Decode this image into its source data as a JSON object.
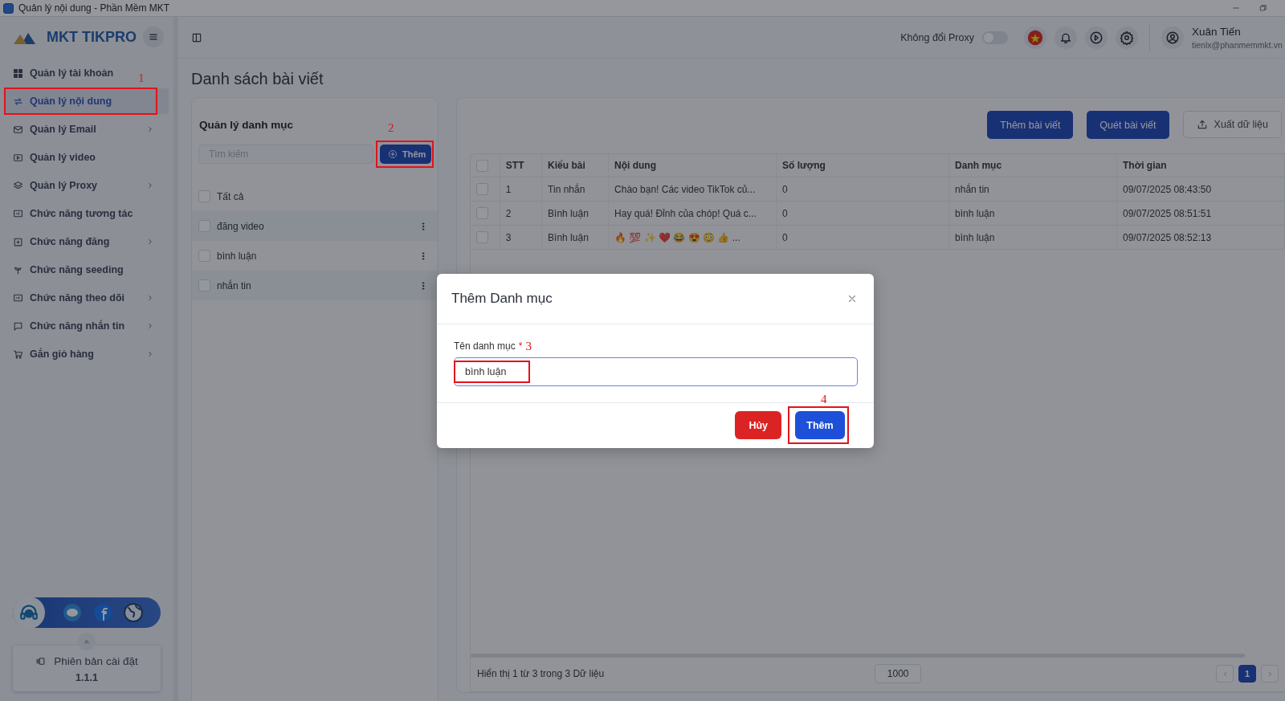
{
  "window": {
    "title": "Quản lý nội dung - Phần Mềm MKT"
  },
  "sidebar": {
    "logo": "MKT TIKPRO",
    "items": [
      {
        "label": "Quản lý tài khoản",
        "selected": false,
        "has_submenu": false
      },
      {
        "label": "Quản lý nội dung",
        "selected": true,
        "has_submenu": false,
        "annotation": "1"
      },
      {
        "label": "Quản lý Email",
        "selected": false,
        "has_submenu": true
      },
      {
        "label": "Quản lý video",
        "selected": false,
        "has_submenu": false
      },
      {
        "label": "Quản lý Proxy",
        "selected": false,
        "has_submenu": true
      },
      {
        "label": "Chức năng tương tác",
        "selected": false,
        "has_submenu": false
      },
      {
        "label": "Chức năng đăng",
        "selected": false,
        "has_submenu": true
      },
      {
        "label": "Chức năng seeding",
        "selected": false,
        "has_submenu": false
      },
      {
        "label": "Chức năng theo dõi",
        "selected": false,
        "has_submenu": true
      },
      {
        "label": "Chức năng nhắn tin",
        "selected": false,
        "has_submenu": true
      },
      {
        "label": "Gắn giỏ hàng",
        "selected": false,
        "has_submenu": true
      }
    ],
    "version": {
      "label": "Phiên bản cài đặt",
      "value": "1.1.1"
    }
  },
  "topbar": {
    "proxy_label": "Không đổi Proxy",
    "proxy_on": false,
    "user_name": "Xuân Tiến",
    "user_email": "tienlx@phanmemmkt.vn"
  },
  "page_title": "Danh sách bài viết",
  "category_panel": {
    "title": "Quản lý danh mục",
    "search": {
      "placeholder": "Tìm kiếm"
    },
    "add_button": {
      "label": "Thêm",
      "annotation": "2"
    },
    "items": [
      {
        "label": "Tất cả",
        "checked": false
      },
      {
        "label": "đăng video",
        "checked": false
      },
      {
        "label": "bình luận",
        "checked": false
      },
      {
        "label": "nhắn tin",
        "checked": false
      }
    ]
  },
  "posts_panel": {
    "buttons": [
      {
        "label": "Thêm bài viết",
        "kind": "primary"
      },
      {
        "label": "Quét bài viết",
        "kind": "primary"
      },
      {
        "label": "Xuất dữ liệu",
        "kind": "export"
      }
    ],
    "table": {
      "all_checked": false,
      "columns": [
        "STT",
        "Kiểu bài",
        "Nội dung",
        "Số lượng",
        "Danh mục",
        "Thời gian"
      ],
      "rows": [
        {
          "checked": false,
          "cells": [
            "1",
            "Tin nhắn",
            "Chào bạn! Các video TikTok củ...",
            "0",
            "nhắn tin",
            "09/07/2025 08:43:50"
          ]
        },
        {
          "checked": false,
          "cells": [
            "2",
            "Bình luận",
            "Hay quá! Đỉnh của chóp! Quá c...",
            "0",
            "bình luận",
            "09/07/2025 08:51:51"
          ]
        },
        {
          "checked": false,
          "cells": [
            "3",
            "Bình luận",
            "🔥 💯 ✨ ❤️ 😂 😍 😳 👍 ...",
            "0",
            "bình luận",
            "09/07/2025 08:52:13"
          ]
        }
      ]
    },
    "footer": {
      "summary": "Hiển thị 1 từ 3 trong 3 Dữ liệu",
      "page_size": "1000",
      "pages": [
        {
          "label": "1",
          "selected": true
        }
      ]
    }
  },
  "modal": {
    "title": "Thêm Danh mục",
    "field": {
      "label": "Tên danh mục",
      "required_mark": "*",
      "value": "bình luận",
      "annotation": "3"
    },
    "buttons": [
      {
        "label": "Hủy",
        "kind": "danger"
      },
      {
        "label": "Thêm",
        "kind": "primary",
        "annotation": "4"
      }
    ]
  }
}
